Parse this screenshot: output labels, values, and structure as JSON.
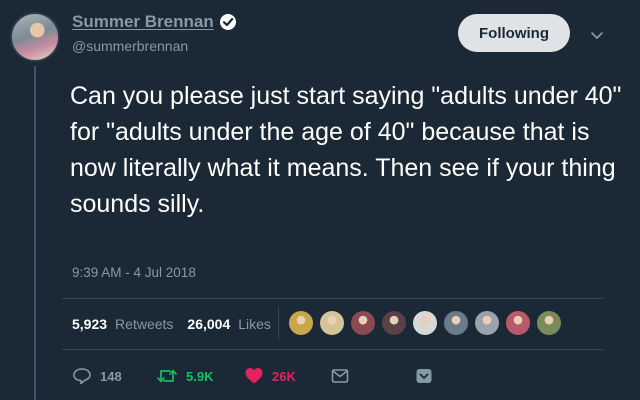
{
  "author": {
    "display_name": "Summer Brennan",
    "handle": "@summerbrennan",
    "verified": true
  },
  "follow_button": {
    "label": "Following"
  },
  "tweet": {
    "text": "Can you please just start saying \"adults under 40\" for \"adults under the age of 40\" because that is now literally what it means. Then see if your thing sounds silly.",
    "timestamp": "9:39 AM - 4 Jul 2018"
  },
  "stats": {
    "retweets_count": "5,923",
    "retweets_label": "Retweets",
    "likes_count": "26,004",
    "likes_label": "Likes"
  },
  "likers": [
    {
      "name": "liker-avatar-1",
      "color": "#c9a64a"
    },
    {
      "name": "liker-avatar-2",
      "color": "#d7c39a"
    },
    {
      "name": "liker-avatar-3",
      "color": "#8a4a52"
    },
    {
      "name": "liker-avatar-4",
      "color": "#5a4048"
    },
    {
      "name": "liker-avatar-5",
      "color": "#d8d8d8"
    },
    {
      "name": "liker-avatar-6",
      "color": "#6b7a8a"
    },
    {
      "name": "liker-avatar-7",
      "color": "#9aa2ab"
    },
    {
      "name": "liker-avatar-8",
      "color": "#b85a6b"
    },
    {
      "name": "liker-avatar-9",
      "color": "#7a8a5a"
    }
  ],
  "actions": {
    "reply_count": "148",
    "retweet_count": "5.9K",
    "like_count": "26K"
  },
  "colors": {
    "background": "#1b2836",
    "muted": "#8899a6",
    "retweet_green": "#17bf63",
    "like_red": "#e0245e"
  }
}
